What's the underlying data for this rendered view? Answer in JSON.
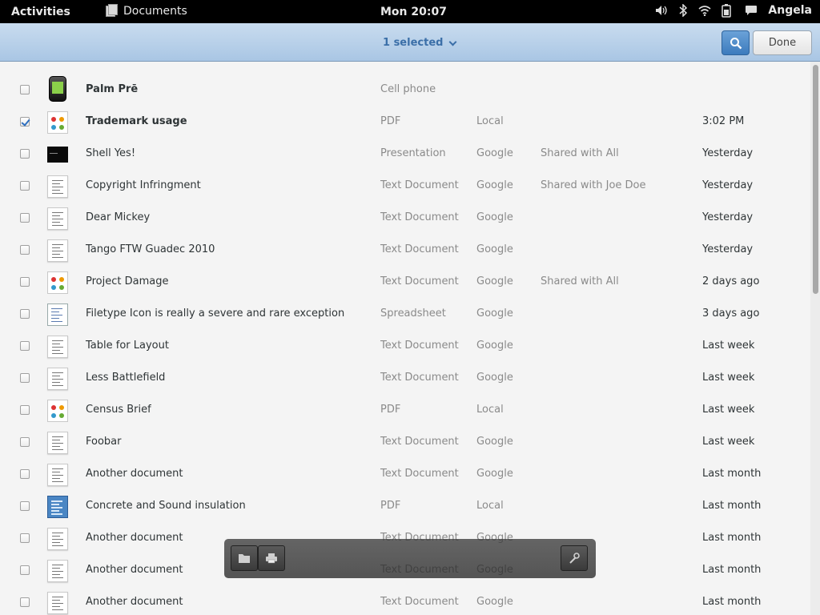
{
  "topbar": {
    "activities": "Activities",
    "app_name": "Documents",
    "clock": "Mon 20:07",
    "user": "Angela"
  },
  "header": {
    "selection_label": "1 selected",
    "done_label": "Done"
  },
  "rows": [
    {
      "title": "Palm Prē",
      "type": "Cell phone",
      "source": "",
      "shared": "",
      "date": "",
      "checked": false,
      "bold": true,
      "thumb": "phone"
    },
    {
      "title": "Trademark usage",
      "type": "PDF",
      "source": "Local",
      "shared": "",
      "date": "3:02 PM",
      "checked": true,
      "bold": true,
      "thumb": "color"
    },
    {
      "title": "Shell Yes!",
      "type": "Presentation",
      "source": "Google",
      "shared": "Shared with All",
      "date": "Yesterday",
      "checked": false,
      "bold": false,
      "thumb": "presentation"
    },
    {
      "title": "Copyright Infringment",
      "type": "Text Document",
      "source": "Google",
      "shared": "Shared with Joe Doe",
      "date": "Yesterday",
      "checked": false,
      "bold": false,
      "thumb": "doc"
    },
    {
      "title": "Dear Mickey",
      "type": "Text Document",
      "source": "Google",
      "shared": "",
      "date": "Yesterday",
      "checked": false,
      "bold": false,
      "thumb": "doc"
    },
    {
      "title": "Tango FTW Guadec 2010",
      "type": "Text Document",
      "source": "Google",
      "shared": "",
      "date": "Yesterday",
      "checked": false,
      "bold": false,
      "thumb": "doc"
    },
    {
      "title": "Project Damage",
      "type": "Text Document",
      "source": "Google",
      "shared": "Shared with All",
      "date": "2 days ago",
      "checked": false,
      "bold": false,
      "thumb": "color"
    },
    {
      "title": "Filetype Icon is really a severe and rare exception",
      "type": "Spreadsheet",
      "source": "Google",
      "shared": "",
      "date": "3 days ago",
      "checked": false,
      "bold": false,
      "thumb": "spreadsheet"
    },
    {
      "title": "Table for Layout",
      "type": "Text Document",
      "source": "Google",
      "shared": "",
      "date": "Last week",
      "checked": false,
      "bold": false,
      "thumb": "doc"
    },
    {
      "title": "Less Battlefield",
      "type": "Text Document",
      "source": "Google",
      "shared": "",
      "date": "Last week",
      "checked": false,
      "bold": false,
      "thumb": "doc"
    },
    {
      "title": "Census Brief",
      "type": "PDF",
      "source": "Local",
      "shared": "",
      "date": "Last week",
      "checked": false,
      "bold": false,
      "thumb": "color"
    },
    {
      "title": "Foobar",
      "type": "Text Document",
      "source": "Google",
      "shared": "",
      "date": "Last week",
      "checked": false,
      "bold": false,
      "thumb": "doc"
    },
    {
      "title": "Another document",
      "type": "Text Document",
      "source": "Google",
      "shared": "",
      "date": "Last month",
      "checked": false,
      "bold": false,
      "thumb": "doc"
    },
    {
      "title": "Concrete and Sound insulation",
      "type": "PDF",
      "source": "Local",
      "shared": "",
      "date": "Last month",
      "checked": false,
      "bold": false,
      "thumb": "blue"
    },
    {
      "title": "Another document",
      "type": "Text Document",
      "source": "Google",
      "shared": "",
      "date": "Last month",
      "checked": false,
      "bold": false,
      "thumb": "doc"
    },
    {
      "title": "Another document",
      "type": "Text Document",
      "source": "Google",
      "shared": "",
      "date": "Last month",
      "checked": false,
      "bold": false,
      "thumb": "doc"
    },
    {
      "title": "Another document",
      "type": "Text Document",
      "source": "Google",
      "shared": "",
      "date": "Last month",
      "checked": false,
      "bold": false,
      "thumb": "doc"
    }
  ],
  "selection_toolbar": {
    "icons": [
      "folder-icon",
      "print-icon",
      "properties-icon"
    ]
  },
  "colors": {
    "header_top": "#c9dcef",
    "header_bottom": "#a9c6e4",
    "accent": "#3b6fa8",
    "background": "#f4f4f4"
  }
}
